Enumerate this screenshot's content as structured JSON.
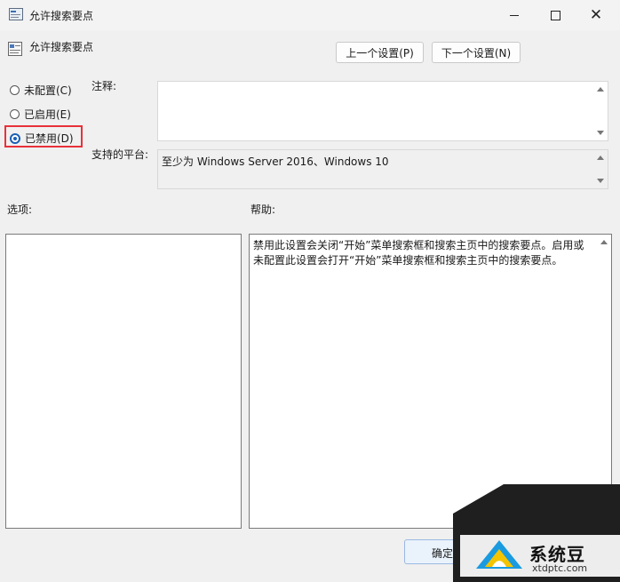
{
  "window": {
    "title": "允许搜索要点"
  },
  "header": {
    "title": "允许搜索要点"
  },
  "nav": {
    "prev_label": "上一个设置(P)",
    "next_label": "下一个设置(N)"
  },
  "state": {
    "options": [
      {
        "label": "未配置(C)",
        "checked": false
      },
      {
        "label": "已启用(E)",
        "checked": false
      },
      {
        "label": "已禁用(D)",
        "checked": true
      }
    ]
  },
  "comment": {
    "label": "注释:",
    "value": ""
  },
  "platform": {
    "label": "支持的平台:",
    "value": "至少为 Windows Server 2016、Windows 10"
  },
  "options_pane": {
    "label": "选项:"
  },
  "help_pane": {
    "label": "帮助:",
    "text": "禁用此设置会关闭“开始”菜单搜索框和搜索主页中的搜索要点。启用或未配置此设置会打开“开始”菜单搜索框和搜索主页中的搜索要点。"
  },
  "footer": {
    "ok_label": "确定"
  },
  "watermark": {
    "name": "系统豆",
    "url": "xtdptc.com"
  },
  "colors": {
    "accent": "#1a5fb4",
    "highlight": "#e8313a"
  }
}
